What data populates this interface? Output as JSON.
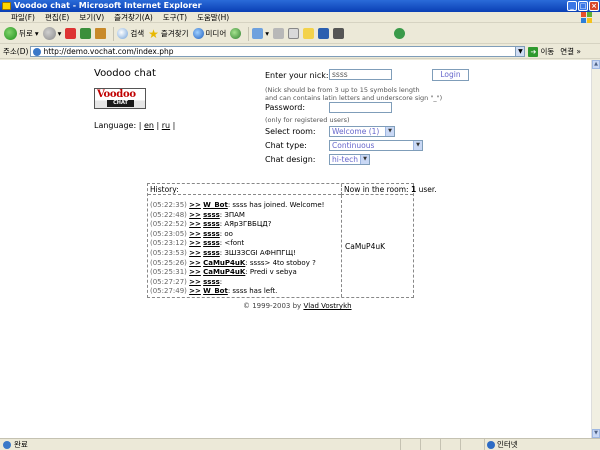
{
  "window": {
    "title": "Voodoo chat - Microsoft Internet Explorer",
    "buttons": {
      "minimize": "_",
      "maximize": "□",
      "close": "×"
    }
  },
  "menu": [
    "파일(F)",
    "편집(E)",
    "보기(V)",
    "즐겨찾기(A)",
    "도구(T)",
    "도움말(H)"
  ],
  "toolbar": {
    "back": "뒤로",
    "search": "검색",
    "favorites": "즐겨찾기",
    "media": "미디어"
  },
  "address": {
    "label": "주소(D)",
    "url": "http://demo.vochat.com/index.php",
    "go": "이동",
    "links": "연결 »"
  },
  "page": {
    "site_title": "Voodoo chat",
    "logo_top": "Voodoo",
    "logo_bottom": "CHAT",
    "language_label": "Language:",
    "lang_en": "en",
    "lang_ru": "ru",
    "nick_label": "Enter your nick:",
    "nick_value": "ssss",
    "login_label": "Login",
    "nick_hint1": "(Nick should be from 3 up to 15 symbols length",
    "nick_hint2": "and can contains latin letters and underscore sign \"_\")",
    "password_label": "Password:",
    "password_hint": "(only for registered users)",
    "room_label": "Select room:",
    "room_value": "Welcome (1)",
    "chat_type_label": "Chat type:",
    "chat_type_value": "Continuous",
    "design_label": "Chat design:",
    "design_value": "hi-tech",
    "history_label": "History:",
    "room_head_prefix": "Now in the room:",
    "room_count": "1",
    "room_head_suffix": "user.",
    "room_user": "CaMuP4uK",
    "footer_copyright": "© 1999-2003 by",
    "footer_author": "Vlad Vostrykh"
  },
  "messages": [
    {
      "time": "(05:22:35)",
      "nick": "W_Bot",
      "text": ": ssss has joined. Welcome!"
    },
    {
      "time": "(05:22:48)",
      "nick": "ssss",
      "text": ": ЗПАМ"
    },
    {
      "time": "(05:22:52)",
      "nick": "ssss",
      "text": ": АЯрЗГВБЦД?"
    },
    {
      "time": "(05:23:05)",
      "nick": "ssss",
      "text": ": oo"
    },
    {
      "time": "(05:23:12)",
      "nick": "ssss",
      "text": ": <font"
    },
    {
      "time": "(05:23:53)",
      "nick": "ssss",
      "text": ": ЗШЗЗСGI АФНПГЩ!"
    },
    {
      "time": "(05:25:26)",
      "nick": "CaMuP4uK",
      "text": ": ssss> 4to stoboy ?"
    },
    {
      "time": "(05:25:31)",
      "nick": "CaMuP4uK",
      "text": ": Predi v sebya"
    },
    {
      "time": "(05:27:27)",
      "nick": "ssss",
      "text": ":"
    },
    {
      "time": "(05:27:49)",
      "nick": "W_Bot",
      "text": ": ssss has left."
    }
  ],
  "msg_arrow": ">>",
  "status": {
    "text": "완료",
    "zone": "인터넷"
  }
}
